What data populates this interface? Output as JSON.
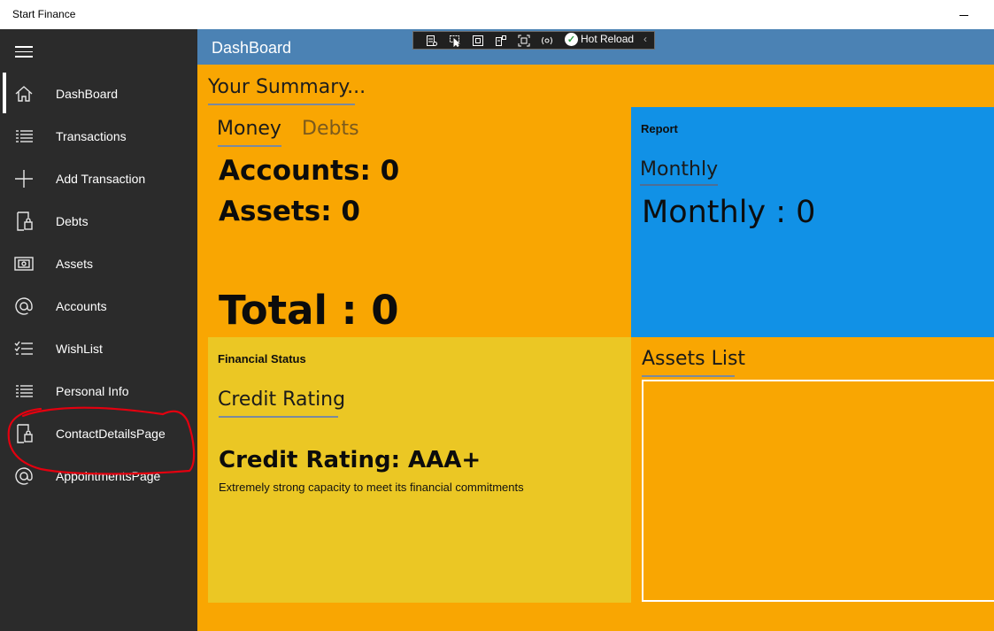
{
  "window": {
    "title": "Start Finance"
  },
  "header": {
    "page_title": "DashBoard"
  },
  "debug_toolbar": {
    "hot_reload_label": "Hot Reload",
    "icons": [
      "live-visual-tree-icon",
      "select-element-icon",
      "display-layout-adorners-icon",
      "track-focus-icon",
      "display-element-bounds-icon",
      "binding-failures-icon"
    ]
  },
  "sidebar": {
    "items": [
      {
        "label": "DashBoard",
        "icon": "home-icon",
        "selected": true
      },
      {
        "label": "Transactions",
        "icon": "list-icon"
      },
      {
        "label": "Add Transaction",
        "icon": "plus-icon"
      },
      {
        "label": "Debts",
        "icon": "lock-page-icon"
      },
      {
        "label": "Assets",
        "icon": "photo-frame-icon"
      },
      {
        "label": "Accounts",
        "icon": "at-sign-icon"
      },
      {
        "label": "WishList",
        "icon": "checklist-icon"
      },
      {
        "label": "Personal Info",
        "icon": "list-icon"
      },
      {
        "label": "ContactDetailsPage",
        "icon": "lock-page-icon"
      },
      {
        "label": "AppointmentsPage",
        "icon": "at-sign-icon"
      }
    ]
  },
  "summary": {
    "title": "Your Summary...",
    "tabs": {
      "money": "Money",
      "debts": "Debts"
    },
    "accounts_line": "Accounts: 0",
    "assets_line": "Assets: 0",
    "total_line": "Total : 0"
  },
  "report": {
    "heading": "Report",
    "tab": "Monthly",
    "value_line": "Monthly : 0"
  },
  "financial_status": {
    "heading": "Financial Status",
    "tab": "Credit Rating",
    "value_line": "Credit Rating: AAA+",
    "description": "Extremely strong capacity to meet its financial commitments"
  },
  "assets_list": {
    "title": "Assets List"
  },
  "colors": {
    "sidebar_bg": "#2b2b2b",
    "header_bg": "#4b82b4",
    "content_bg": "#f9a602",
    "report_tile": "#1191e6",
    "financial_tile": "#ebc724",
    "annotation": "#e3000f"
  }
}
